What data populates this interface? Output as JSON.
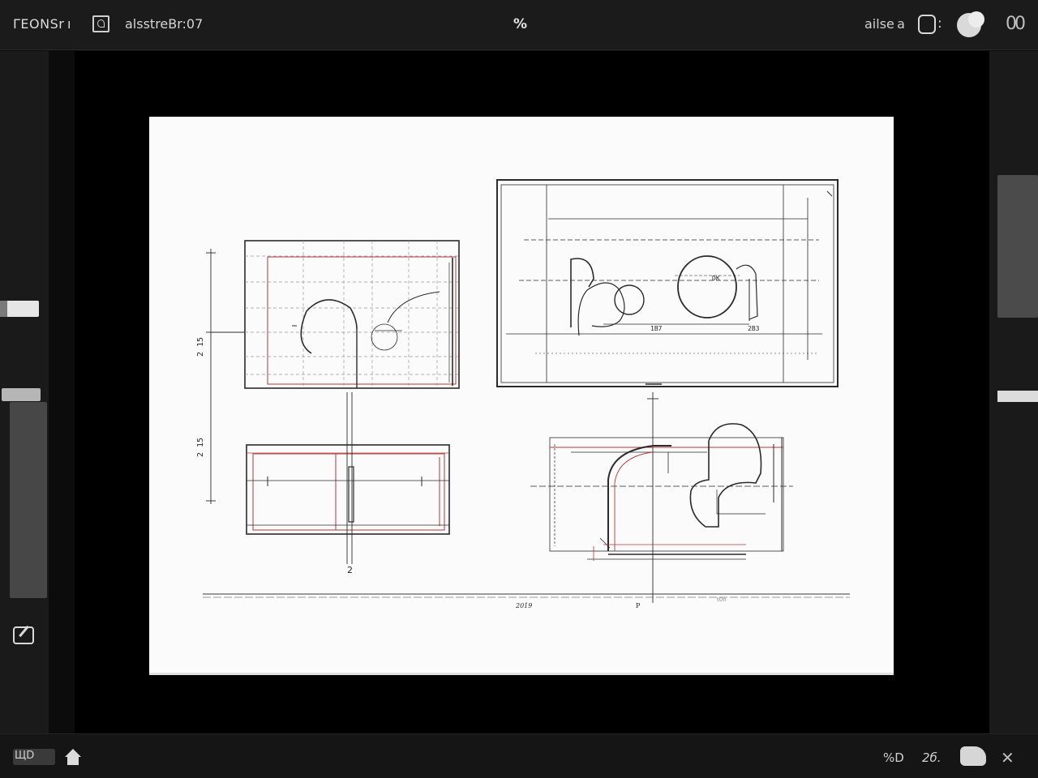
{
  "header": {
    "app_title": "ΓEONSr ı",
    "document_name": "alsstreBr:07",
    "center_logo": "%",
    "zoom_label": "ailse a",
    "zoom_separator": ":",
    "more_menu": "00"
  },
  "drawing": {
    "top_view_text": [
      "1B7",
      "2B3",
      "DK"
    ],
    "left_dimensions": [
      "2 15",
      "2 15"
    ],
    "left_view_label": "2",
    "footer_left": "2019",
    "footer_center": "P",
    "footer_right": "t0n"
  },
  "footer": {
    "page_indicator": "ЩD",
    "grid_toggle": "%D",
    "page_count": "2б."
  },
  "icons": {
    "doc": "document-icon",
    "home": "home-icon",
    "edit": "edit-icon",
    "theme": "theme-toggle-icon",
    "view": "view-mode-icon",
    "close": "close-icon"
  },
  "colors": {
    "chrome": "#1b1b1b",
    "canvas": "#000000",
    "paper": "#fbfbfb",
    "ink": "#2b2b2b",
    "red_line": "#b33a3a"
  }
}
